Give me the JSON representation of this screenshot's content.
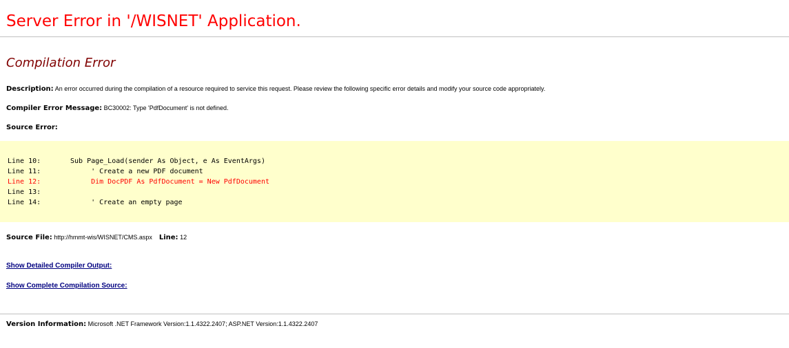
{
  "title": "Server Error in '/WISNET' Application.",
  "subtitle": "Compilation Error",
  "description": {
    "label": "Description:",
    "text": "An error occurred during the compilation of a resource required to service this request. Please review the following specific error details and modify your source code appropriately."
  },
  "compiler_error": {
    "label": "Compiler Error Message:",
    "text": "BC30002: Type 'PdfDocument' is not defined."
  },
  "source_error": {
    "label": "Source Error:",
    "lines": [
      {
        "num": "Line 10:",
        "code": "Sub Page_Load(sender As Object, e As EventArgs)",
        "error": false
      },
      {
        "num": "Line 11:",
        "code": "     ' Create a new PDF document",
        "error": false
      },
      {
        "num": "Line 12:",
        "code": "     Dim DocPDF As PdfDocument = New PdfDocument",
        "error": true
      },
      {
        "num": "Line 13:",
        "code": "",
        "error": false
      },
      {
        "num": "Line 14:",
        "code": "     ' Create an empty page",
        "error": false
      }
    ]
  },
  "source_file": {
    "label": "Source File:",
    "path": "http://hmmt-wis/WISNET/CMS.aspx",
    "line_label": "Line:",
    "line_value": "12"
  },
  "links": {
    "detailed_output": "Show Detailed Compiler Output:",
    "complete_source": "Show Complete Compilation Source:"
  },
  "version": {
    "label": "Version Information:",
    "text": "Microsoft .NET Framework Version:1.1.4322.2407; ASP.NET Version:1.1.4322.2407"
  },
  "colors": {
    "title": "#ff0000",
    "subtitle": "#800000",
    "code_background": "#ffffcc",
    "error_line": "#ff0000",
    "link": "#000080",
    "rule": "#c0c0c0"
  }
}
